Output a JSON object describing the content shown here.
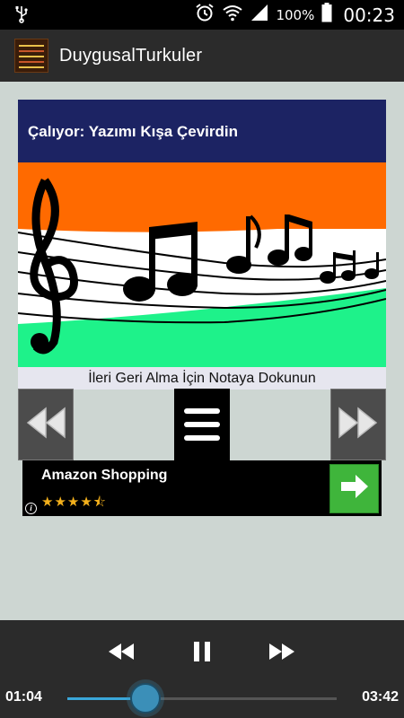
{
  "status_bar": {
    "battery_percent": "100%",
    "time": "00:23",
    "icons": [
      "usb-icon",
      "alarm-icon",
      "wifi-icon",
      "signal-icon",
      "battery-icon"
    ]
  },
  "app_bar": {
    "title": "DuygusalTurkuler"
  },
  "now_playing": {
    "label": "Çalıyor: Yazımı Kışa Çevirdin"
  },
  "artwork": {
    "colors": [
      "#ff6a00",
      "#ffffff",
      "#1ef28a"
    ],
    "icon": "music-notes-artwork"
  },
  "hint": {
    "text": "İleri Geri Alma İçin Notaya Dokunun"
  },
  "controls": {
    "rewind_icon": "rewind-icon",
    "menu_icon": "hamburger-menu-icon",
    "forward_icon": "fast-forward-icon"
  },
  "ad": {
    "title": "Amazon Shopping",
    "stars": "★★★★⯪",
    "rating": 4.5,
    "info_icon": "info-icon",
    "go_icon": "arrow-right-icon",
    "accent": "#3fb53b"
  },
  "player": {
    "current_time": "01:04",
    "duration": "03:42",
    "progress_fraction": 0.29,
    "accent": "#3aa7d9"
  }
}
